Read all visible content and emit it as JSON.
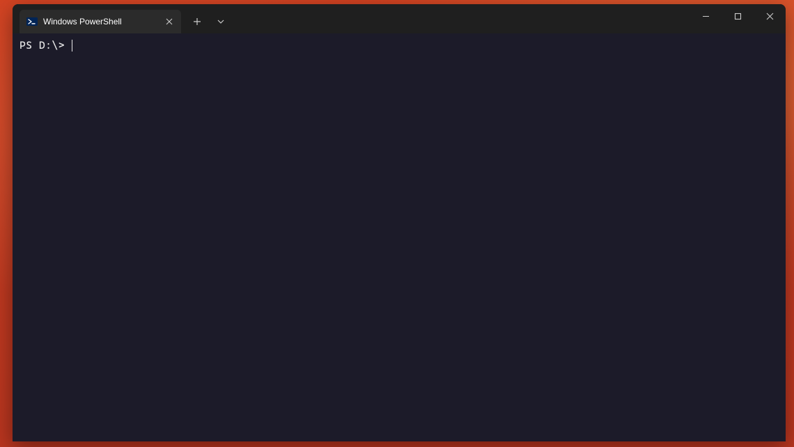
{
  "tab": {
    "title": "Windows PowerShell",
    "icon": "powershell-icon"
  },
  "terminal": {
    "prompt": "PS D:\\> "
  },
  "colors": {
    "titlebar": "#1f1f1f",
    "tab_active": "#2b2b2b",
    "terminal_bg": "#1c1b29",
    "terminal_fg": "#e8e8e8"
  }
}
